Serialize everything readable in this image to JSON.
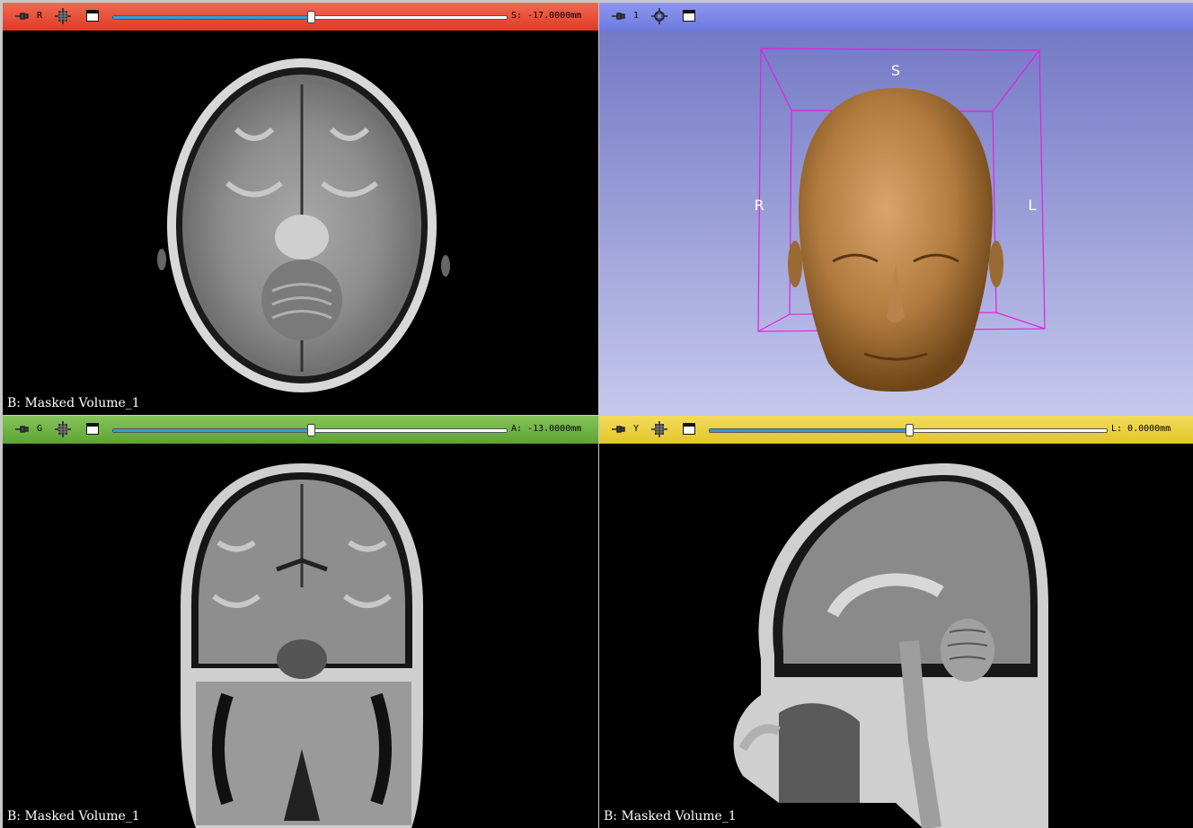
{
  "red": {
    "letter": "R",
    "offset": "S: -17.0000mm",
    "slider_fraction": 0.5,
    "volume_label": "B: Masked Volume_1",
    "color": "#e8513a"
  },
  "threed": {
    "letter": "1",
    "orient": {
      "s": "S",
      "r": "R",
      "l": "L"
    },
    "color": "#7b86e6"
  },
  "green": {
    "letter": "G",
    "offset": "A: -13.0000mm",
    "slider_fraction": 0.5,
    "volume_label": "B: Masked Volume_1",
    "color": "#6cb043"
  },
  "yellow": {
    "letter": "Y",
    "offset": "L: 0.0000mm",
    "slider_fraction": 0.5,
    "volume_label": "B: Masked Volume_1",
    "color": "#e9cf3e"
  }
}
